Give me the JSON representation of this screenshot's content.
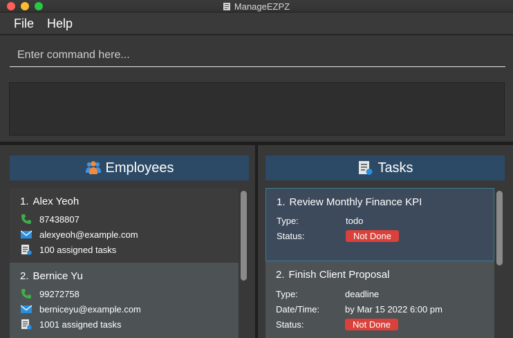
{
  "window": {
    "title": "ManageEZPZ"
  },
  "menu": {
    "file": "File",
    "help": "Help"
  },
  "command": {
    "placeholder": "Enter command here...",
    "value": ""
  },
  "result": {
    "text": ""
  },
  "employees": {
    "header": "Employees",
    "items": [
      {
        "index": "1.",
        "name": "Alex Yeoh",
        "phone": "87438807",
        "email": "alexyeoh@example.com",
        "tasks": "100 assigned tasks"
      },
      {
        "index": "2.",
        "name": "Bernice Yu",
        "phone": "99272758",
        "email": "berniceyu@example.com",
        "tasks": "1001 assigned tasks"
      }
    ]
  },
  "tasks": {
    "header": "Tasks",
    "labels": {
      "type": "Type:",
      "status": "Status:",
      "datetime": "Date/Time:"
    },
    "items": [
      {
        "index": "1.",
        "title": "Review Monthly Finance KPI",
        "type": "todo",
        "status": "Not Done"
      },
      {
        "index": "2.",
        "title": "Finish Client Proposal",
        "type": "deadline",
        "datetime": "by Mar 15 2022 6:00 pm",
        "status": "Not Done"
      }
    ]
  },
  "colors": {
    "panel_header": "#2c4a66",
    "status_not_done": "#d9413a",
    "phone_icon": "#3fae49",
    "email_icon": "#2a8fe0"
  }
}
